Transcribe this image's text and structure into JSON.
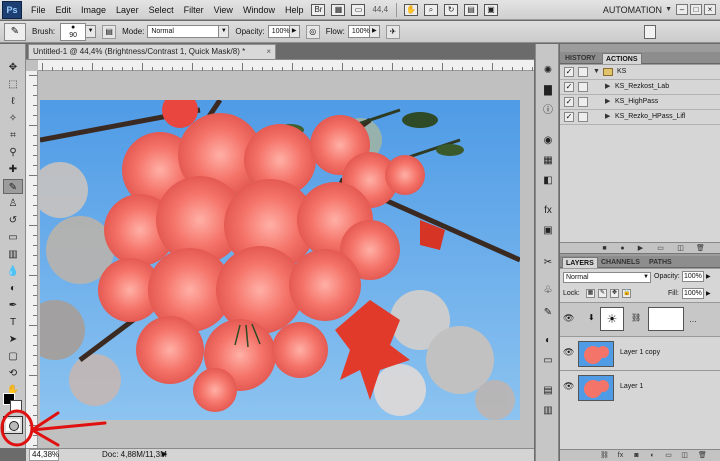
{
  "menubar": {
    "logo": "Ps",
    "items": [
      "File",
      "Edit",
      "Image",
      "Layer",
      "Select",
      "Filter",
      "View",
      "Window",
      "Help"
    ],
    "zoom": "44,4",
    "workspace": "AUTOMATION"
  },
  "options": {
    "brush_label": "Brush:",
    "brush_size": "90",
    "mode_label": "Mode:",
    "mode_value": "Normal",
    "opacity_label": "Opacity:",
    "opacity_value": "100%",
    "flow_label": "Flow:",
    "flow_value": "100%"
  },
  "document": {
    "tab_title": "Untitled-1 @ 44,4% (Brightness/Contrast 1, Quick Mask/8) *",
    "close": "×",
    "status_zoom": "44,38%",
    "status_doc": "Doc: 4,88M/11,3M"
  },
  "actions_panel": {
    "tabs": [
      "HISTORY",
      "ACTIONS"
    ],
    "set_name": "KS",
    "items": [
      "KS_Rezkost_Lab",
      "KS_HighPass",
      "KS_Rezko_HPass_Lifl"
    ]
  },
  "layers_panel": {
    "tabs": [
      "LAYERS",
      "CHANNELS",
      "PATHS"
    ],
    "blend_mode": "Normal",
    "opacity_label": "Opacity:",
    "opacity_value": "100%",
    "lock_label": "Lock:",
    "fill_label": "Fill:",
    "fill_value": "100%",
    "layers": [
      "Layer 1 copy",
      "Layer 1"
    ]
  },
  "colors": {
    "accent_annotation": "#e01010",
    "sky": "#5aa3e6",
    "blossom": "#f2746c"
  }
}
